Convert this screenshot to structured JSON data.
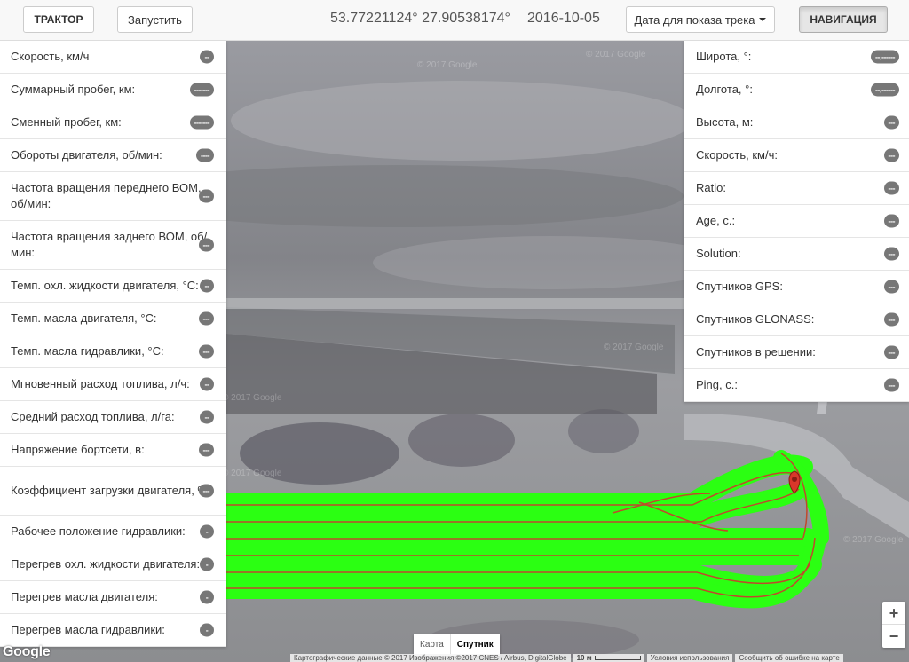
{
  "header": {
    "tractor_label": "ТРАКТОР",
    "start_label": "Запустить",
    "coordinates": "53.77221124° 27.90538174°",
    "date": "2016-10-05",
    "track_date_label": "Дата для показа трека",
    "navigation_label": "НАВИГАЦИЯ"
  },
  "left_panel": {
    "rows": [
      {
        "label": "Скорость, км/ч",
        "value": "--"
      },
      {
        "label": "Суммарный пробег, км:",
        "value": "-------"
      },
      {
        "label": "Сменный пробег, км:",
        "value": "-------"
      },
      {
        "label": "Обороты двигателя, об/мин:",
        "value": "----"
      },
      {
        "label": "Частота вращения переднего ВОМ, об/мин:",
        "value": "---"
      },
      {
        "label": "Частота вращения заднего ВОМ, об/мин:",
        "value": "---"
      },
      {
        "label": "Темп. охл. жидкости двигателя, °C:",
        "value": "--"
      },
      {
        "label": "Темп. масла двигателя, °C:",
        "value": "---"
      },
      {
        "label": "Темп. масла гидравлики, °C:",
        "value": "---"
      },
      {
        "label": "Мгновенный расход топлива, л/ч:",
        "value": "--"
      },
      {
        "label": "Средний расход топлива, л/га:",
        "value": "--"
      },
      {
        "label": "Напряжение бортсети, в:",
        "value": "---"
      },
      {
        "label": "Коэффициент загрузки двигателя, %:",
        "value": "---"
      },
      {
        "label": "Рабочее положение гидравлики:",
        "value": "-"
      },
      {
        "label": "Перегрев охл. жидкости двигателя:",
        "value": "-"
      },
      {
        "label": "Перегрев масла двигателя:",
        "value": "-"
      },
      {
        "label": "Перегрев масла гидравлики:",
        "value": "-"
      }
    ]
  },
  "right_panel": {
    "rows": [
      {
        "label": "Широта, °:",
        "value": "--.------"
      },
      {
        "label": "Долгота, °:",
        "value": "--.------"
      },
      {
        "label": "Высота, м:",
        "value": "---"
      },
      {
        "label": "Скорость, км/ч:",
        "value": "---"
      },
      {
        "label": "Ratio:",
        "value": "---"
      },
      {
        "label": "Age, c.:",
        "value": "---"
      },
      {
        "label": "Solution:",
        "value": "---"
      },
      {
        "label": "Спутников GPS:",
        "value": "---"
      },
      {
        "label": "Спутников GLONASS:",
        "value": "---"
      },
      {
        "label": "Спутников в решении:",
        "value": "---"
      },
      {
        "label": "Ping, c.:",
        "value": "---"
      }
    ]
  },
  "map": {
    "map_type_map": "Карта",
    "map_type_satellite": "Спутник",
    "zoom_in": "+",
    "zoom_out": "−",
    "logo": "Google",
    "attribution_data": "Картографические данные © 2017 Изображения ©2017 CNES / Airbus, DigitalGlobe",
    "scale": "10 м",
    "terms": "Условия использования",
    "report": "Сообщить об ошибке на карте",
    "track_color": "#2bff12",
    "path_color": "#c0492c",
    "marker_color": "#d9372a"
  }
}
